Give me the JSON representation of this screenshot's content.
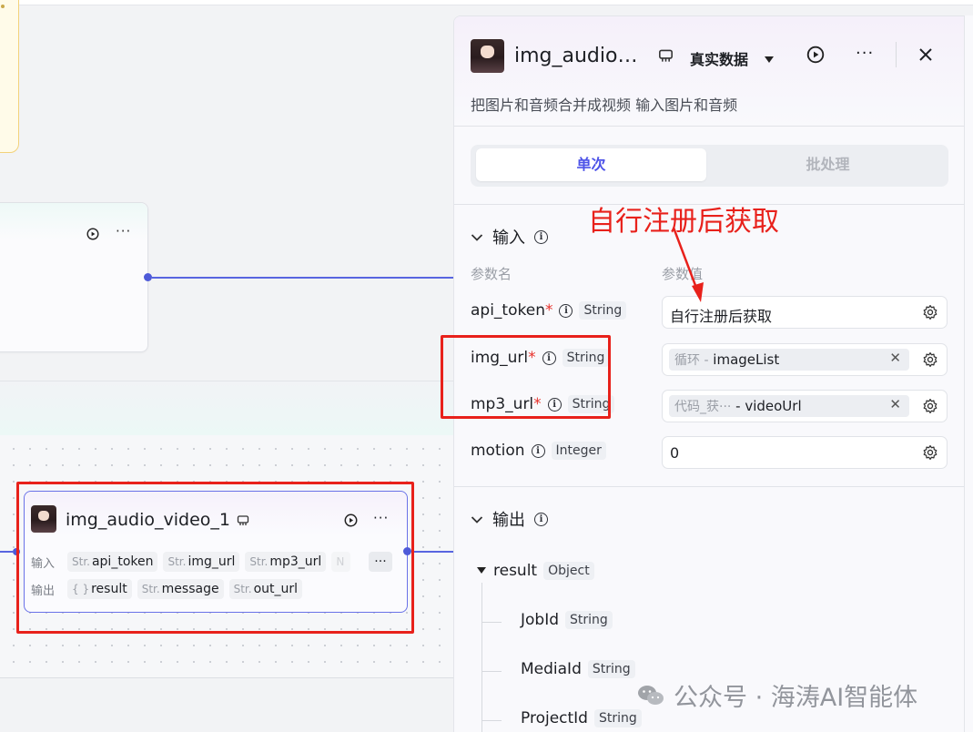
{
  "panel": {
    "title": "img_audio…",
    "data_mode": "真实数据",
    "description": "把图片和音频合并成视频 输入图片和音频",
    "tabs": [
      {
        "label": "单次",
        "active": true
      },
      {
        "label": "批处理",
        "active": false
      }
    ],
    "input_section": {
      "title": "输入",
      "col_name": "参数名",
      "col_value": "参数值",
      "params": [
        {
          "name": "api_token",
          "required": true,
          "type": "String",
          "value": "自行注册后获取"
        },
        {
          "name": "img_url",
          "required": true,
          "type": "String",
          "ref_prefix": "循环 -",
          "ref_value": "imageList"
        },
        {
          "name": "mp3_url",
          "required": true,
          "type": "String",
          "ref_prefix": "代码_获···",
          "ref_value": "- videoUrl"
        },
        {
          "name": "motion",
          "required": false,
          "type": "Integer",
          "value": "0"
        }
      ]
    },
    "output_section": {
      "title": "输出",
      "root": {
        "name": "result",
        "type": "Object"
      },
      "children": [
        {
          "name": "JobId",
          "type": "String"
        },
        {
          "name": "MediaId",
          "type": "String"
        },
        {
          "name": "ProjectId",
          "type": "String"
        }
      ]
    }
  },
  "node": {
    "title": "img_audio_video_1",
    "input_label": "输入",
    "output_label": "输出",
    "inputs": [
      {
        "type": "Str.",
        "name": "api_token"
      },
      {
        "type": "Str.",
        "name": "img_url"
      },
      {
        "type": "Str.",
        "name": "mp3_url"
      },
      {
        "type": "N",
        "name": ""
      }
    ],
    "outputs": [
      {
        "type": "{ }",
        "name": "result"
      },
      {
        "type": "Str.",
        "name": "message"
      },
      {
        "type": "Str.",
        "name": "out_url"
      }
    ]
  },
  "annotation": "自行注册后获取",
  "watermark": "公众号 · 海涛AI智能体",
  "colors": {
    "accent": "#4d53e8",
    "annotation": "#e8211b",
    "edge": "#5865e0"
  }
}
